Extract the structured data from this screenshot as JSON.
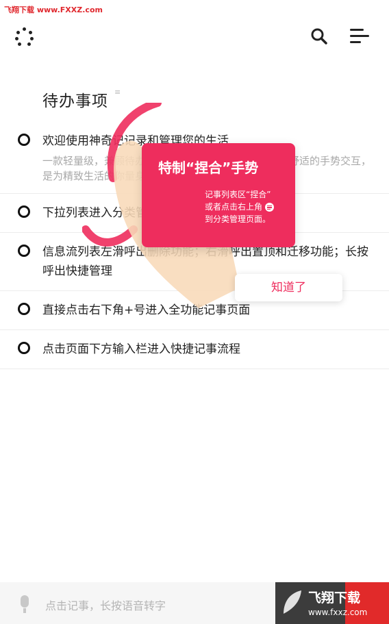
{
  "watermark": "飞翔下载 www.FXXZ.com",
  "header": {
    "title": "待办事项",
    "title_mark": "≡"
  },
  "todos": [
    {
      "text": "欢迎使用神奇记记录和管理您的生活",
      "desc": "一款轻量级，兼顾待办与信息流预览模式；分类管理；舒适的手势交互，是为精致生活的你量身定制的，您值得拥有"
    },
    {
      "text": "下拉列表进入分类管理与定义分类",
      "desc": ""
    },
    {
      "text": "信息流列表左滑呼出删除功能；右滑呼出置顶和迁移功能；长按呼出快捷管理",
      "desc": ""
    },
    {
      "text": "直接点击右下角+号进入全功能记事页面",
      "desc": ""
    },
    {
      "text": "点击页面下方输入栏进入快捷记事流程",
      "desc": ""
    }
  ],
  "hint": {
    "title": "特制“捏合”手势",
    "line1": "记事列表区“捏合”",
    "line2": "或者点击右上角",
    "line3": "到分类管理页面。",
    "button": "知道了"
  },
  "bottombar": {
    "placeholder": "点击记事，长按语音转字"
  },
  "corner_logo": {
    "line1": "飞翔下载",
    "line2": "www.fxxz.com"
  },
  "colors": {
    "accent": "#ee2d5d",
    "watermark_red": "#e12a2a"
  }
}
